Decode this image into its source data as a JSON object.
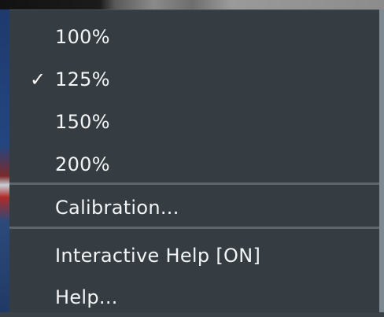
{
  "menu": {
    "zoom_items": [
      {
        "label": "100%",
        "checked": false
      },
      {
        "label": "125%",
        "checked": true
      },
      {
        "label": "150%",
        "checked": false
      },
      {
        "label": "200%",
        "checked": false
      }
    ],
    "check_glyph": "✓",
    "calibration_label": "Calibration...",
    "interactive_help_label": "Interactive Help [ON]",
    "help_label": "Help..."
  },
  "colors": {
    "menu_background": "#353d43",
    "separator": "#5e666c",
    "text": "#f2f4f5"
  }
}
